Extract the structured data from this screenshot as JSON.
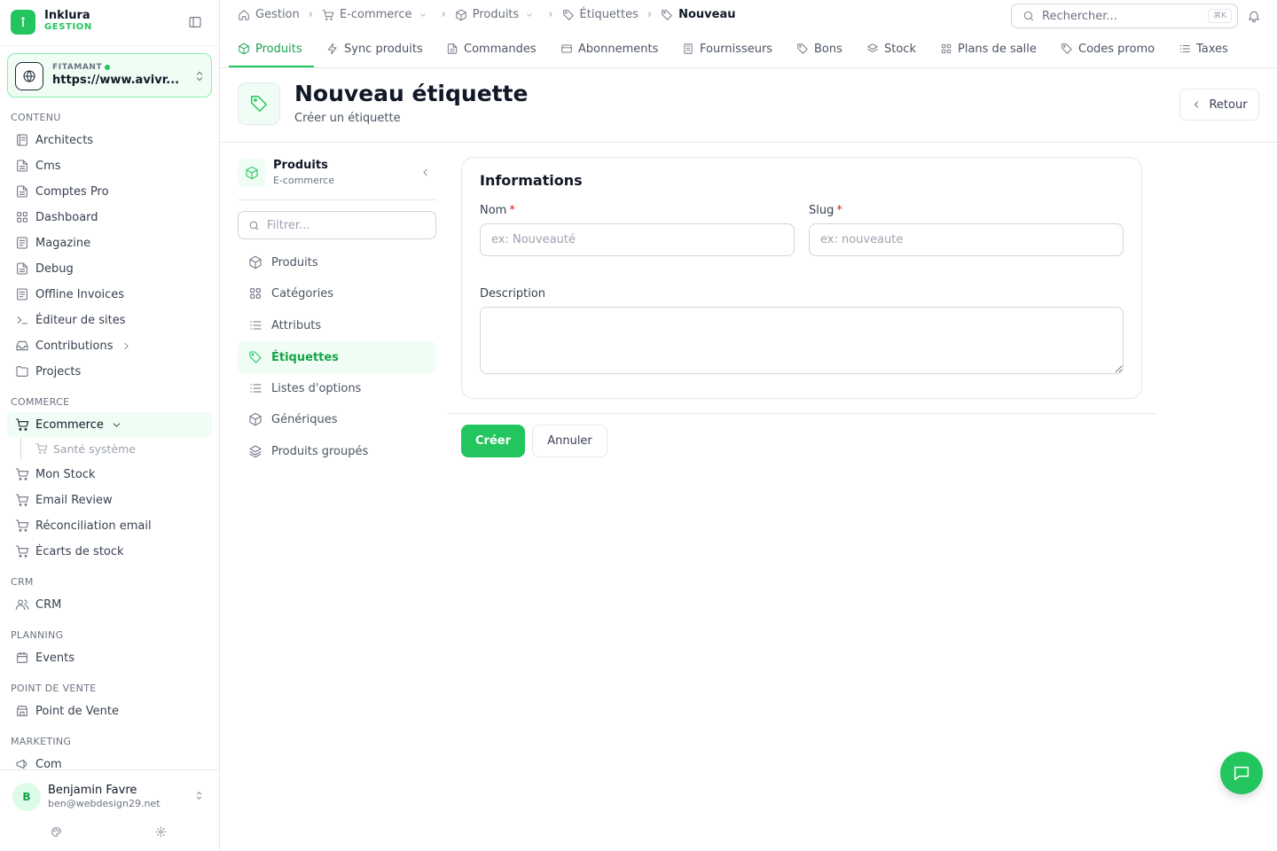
{
  "brand": {
    "name": "Inklura",
    "subtitle": "GESTION"
  },
  "site": {
    "label": "FITAMANT",
    "url": "https://www.avivr..."
  },
  "sidebar": {
    "sections": {
      "contenu": "CONTENU",
      "commerce": "COMMERCE",
      "crm": "CRM",
      "planning": "PLANNING",
      "pos": "POINT DE VENTE",
      "marketing": "MARKETING"
    },
    "items": {
      "architects": "Architects",
      "cms": "Cms",
      "comptes_pro": "Comptes Pro",
      "dashboard": "Dashboard",
      "magazine": "Magazine",
      "debug": "Debug",
      "offline_invoices": "Offline Invoices",
      "editeur_sites": "Éditeur de sites",
      "contributions": "Contributions",
      "projects": "Projects",
      "ecommerce": "Ecommerce",
      "sante_systeme": "Santé système",
      "mon_stock": "Mon Stock",
      "email_review": "Email Review",
      "reconciliation_email": "Réconciliation email",
      "ecarts_stock": "Écarts de stock",
      "crm": "CRM",
      "events": "Events",
      "point_de_vente": "Point de Vente",
      "com": "Com"
    }
  },
  "user": {
    "initial": "B",
    "name": "Benjamin Favre",
    "email": "ben@webdesign29.net"
  },
  "breadcrumb": {
    "gestion": "Gestion",
    "ecommerce": "E-commerce",
    "produits": "Produits",
    "etiquettes": "Étiquettes",
    "current": "Nouveau"
  },
  "search": {
    "placeholder": "Rechercher...",
    "shortcut": "⌘K"
  },
  "tabs": {
    "produits": "Produits",
    "sync": "Sync produits",
    "commandes": "Commandes",
    "abonnements": "Abonnements",
    "fournisseurs": "Fournisseurs",
    "bons": "Bons",
    "stock": "Stock",
    "plans": "Plans de salle",
    "codes": "Codes promo",
    "taxes": "Taxes"
  },
  "page": {
    "title": "Nouveau étiquette",
    "subtitle": "Créer un étiquette",
    "back_label": "Retour"
  },
  "subnav": {
    "title": "Produits",
    "subtitle": "E-commerce",
    "filter_placeholder": "Filtrer...",
    "items": {
      "produits": "Produits",
      "categories": "Catégories",
      "attributs": "Attributs",
      "etiquettes": "Étiquettes",
      "listes": "Listes d'options",
      "generiques": "Génériques",
      "groupes": "Produits groupés"
    }
  },
  "form": {
    "title": "Informations",
    "nom_label": "Nom",
    "nom_placeholder": "ex: Nouveauté",
    "nom_value": "",
    "slug_label": "Slug",
    "slug_placeholder": "ex: nouveaute",
    "slug_value": "",
    "required_mark": "*",
    "description_label": "Description",
    "description_value": "",
    "submit_label": "Créer",
    "cancel_label": "Annuler"
  },
  "colors": {
    "accent": "#22c55e",
    "accent_dark": "#16a34a",
    "accent_bg": "#f0fdf4",
    "required": "#dc2626"
  }
}
